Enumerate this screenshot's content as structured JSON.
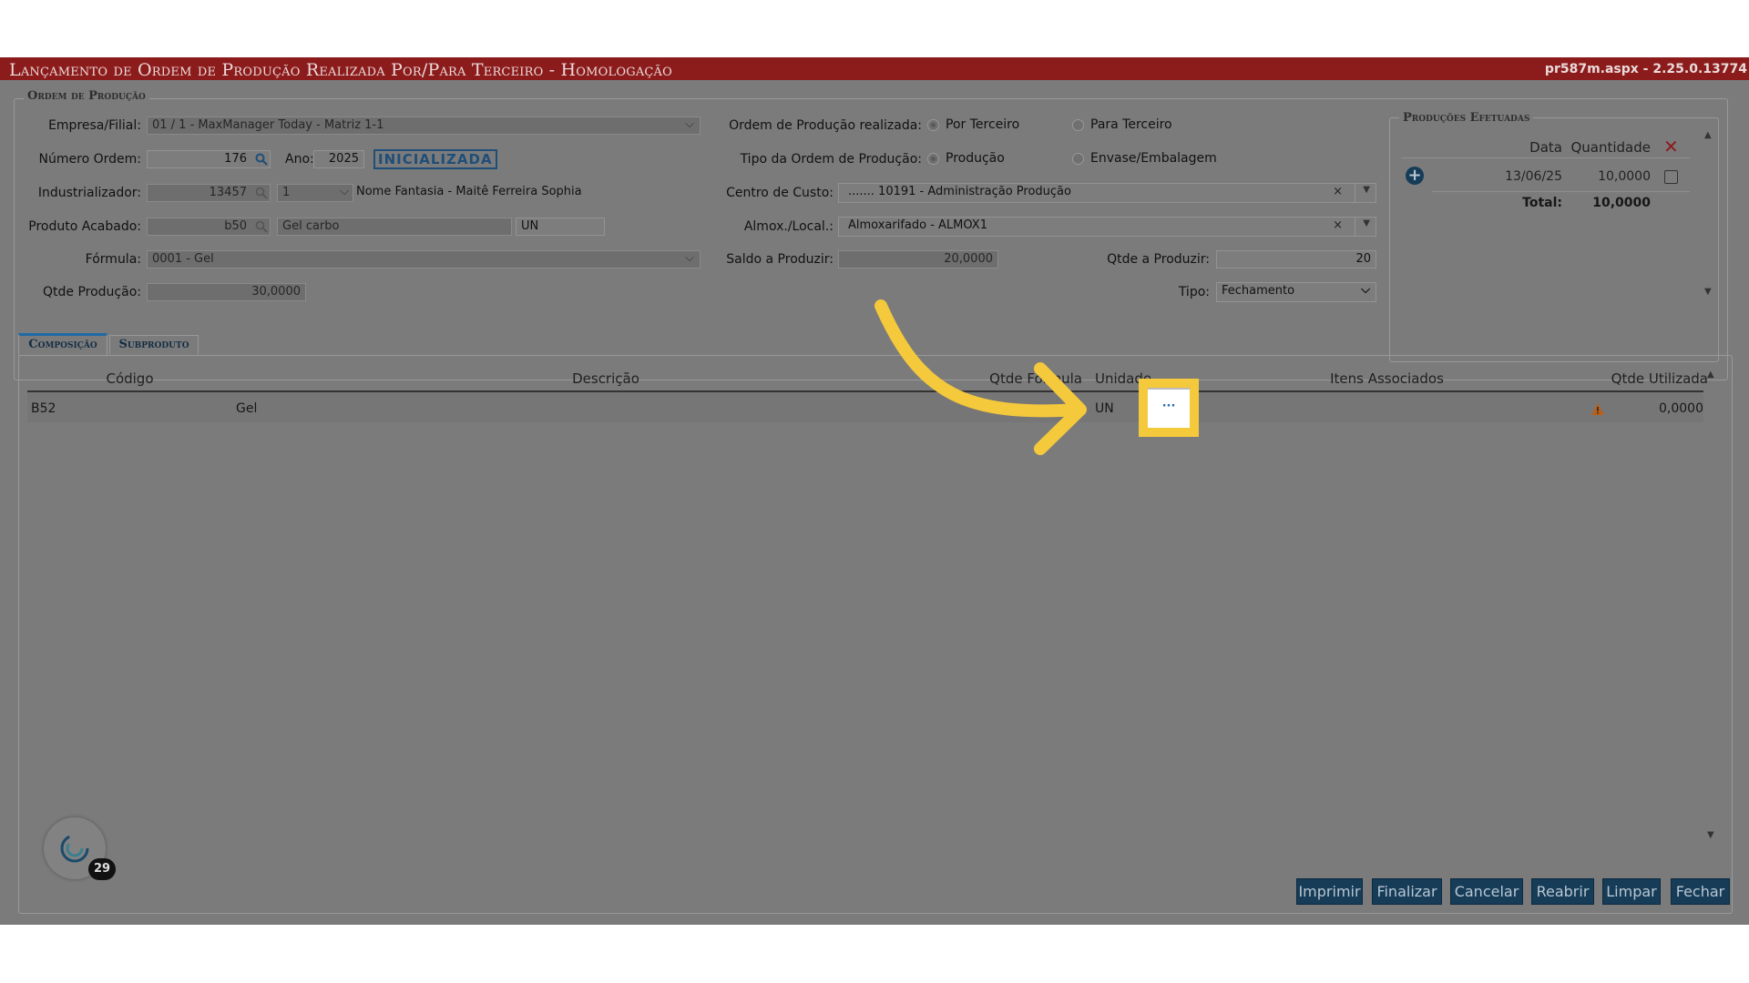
{
  "window": {
    "title": "Lançamento de Ordem de Produção Realizada Por/Para Terceiro  - Homologação",
    "page_info": "pr587m.aspx - 2.25.0.13774"
  },
  "ordem": {
    "legend": "Ordem de Produção",
    "empresa_label": "Empresa/Filial:",
    "empresa_value": "01 / 1 - MaxManager Today - Matriz 1-1",
    "numero_label": "Número Ordem:",
    "numero_value": "176",
    "ano_label": "Ano:",
    "ano_value": "2025",
    "status_tag": "INICIALIZADA",
    "industrializador_label": "Industrializador:",
    "industrializador_code": "13457",
    "industrializador_seq": "1",
    "industrializador_name": "Nome Fantasia - Maitê Ferreira Sophia",
    "produto_label": "Produto Acabado:",
    "produto_code": "b50",
    "produto_desc": "Gel carbo",
    "produto_unit": "UN",
    "formula_label": "Fórmula:",
    "formula_value": "0001 - Gel",
    "qtde_producao_label": "Qtde Produção:",
    "qtde_producao_value": "30,0000",
    "realizada_label": "Ordem de Produção realizada:",
    "realizada_opt1": "Por Terceiro",
    "realizada_opt2": "Para Terceiro",
    "tipo_ordem_label": "Tipo da Ordem de Produção:",
    "tipo_ordem_opt1": "Produção",
    "tipo_ordem_opt2": "Envase/Embalagem",
    "centro_label": "Centro de Custo:",
    "centro_value": "....... 10191 - Administração Produção",
    "almox_label": "Almox./Local.:",
    "almox_value": "Almoxarifado - ALMOX1",
    "saldo_label": "Saldo a Produzir:",
    "saldo_value": "20,0000",
    "qtde_produzir_label": "Qtde a Produzir:",
    "qtde_produzir_value": "20",
    "tipo_label": "Tipo:",
    "tipo_value": "Fechamento"
  },
  "producoes": {
    "legend": "Produções Efetuadas",
    "col_data": "Data",
    "col_qtd": "Quantidade",
    "row_date": "13/06/25",
    "row_qtd": "10,0000",
    "total_label": "Total:",
    "total_value": "10,0000"
  },
  "tabs": [
    "Composição",
    "Subproduto"
  ],
  "grid": {
    "headers": {
      "codigo": "Código",
      "descricao": "Descrição",
      "qtde_formula": "Qtde Fórmula",
      "unidade": "Unidade",
      "itens": "Itens Associados",
      "qtde_utilizada": "Qtde Utilizada"
    },
    "row": {
      "codigo": "B52",
      "descricao": "Gel",
      "unidade": "UN",
      "itens_button": "···",
      "qtde_utilizada": "0,0000"
    }
  },
  "badge_count": "29",
  "buttons": {
    "imprimir": "Imprimir",
    "finalizar": "Finalizar",
    "cancelar": "Cancelar",
    "reabrir": "Reabrir",
    "limpar": "Limpar",
    "fechar": "Fechar"
  },
  "colors": {
    "titlebar": "#8c1b1b",
    "overlay": "#7b7b7b",
    "highlight": "#f5c93c",
    "button": "#163c58",
    "status_tag": "#1f4e79"
  }
}
